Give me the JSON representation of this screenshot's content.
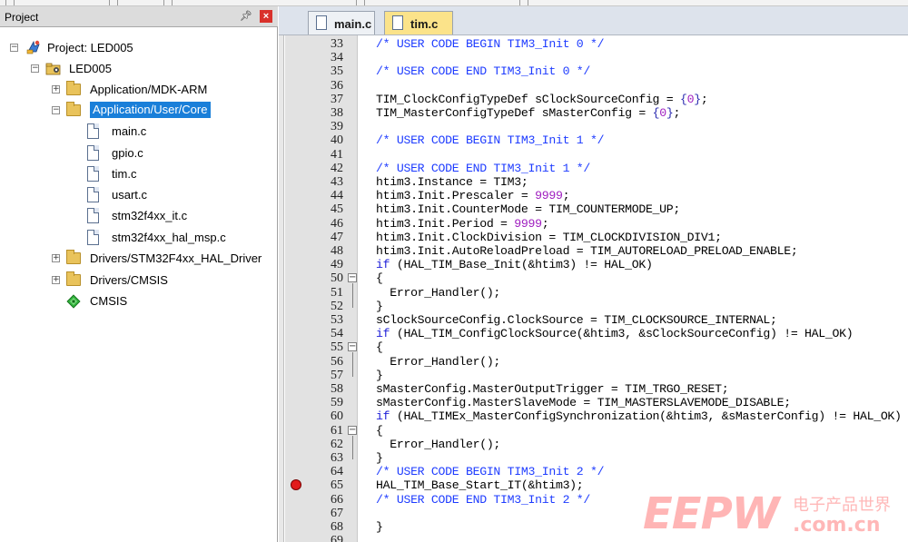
{
  "project_panel": {
    "title": "Project",
    "tree": [
      {
        "label": "Project: LED005",
        "icon": "project-icon",
        "expander": "minus"
      },
      {
        "label": "LED005",
        "icon": "target-group-icon",
        "expander": "minus"
      },
      {
        "label": "Application/MDK-ARM",
        "icon": "folder-icon",
        "expander": "plus"
      },
      {
        "label": "Application/User/Core",
        "icon": "folder-open-icon",
        "expander": "minus",
        "selected": true
      },
      {
        "label": "main.c",
        "icon": "c-file-icon"
      },
      {
        "label": "gpio.c",
        "icon": "c-file-icon"
      },
      {
        "label": "tim.c",
        "icon": "c-file-icon"
      },
      {
        "label": "usart.c",
        "icon": "c-file-icon"
      },
      {
        "label": "stm32f4xx_it.c",
        "icon": "c-file-icon"
      },
      {
        "label": "stm32f4xx_hal_msp.c",
        "icon": "c-file-icon"
      },
      {
        "label": "Drivers/STM32F4xx_HAL_Driver",
        "icon": "folder-icon",
        "expander": "plus"
      },
      {
        "label": "Drivers/CMSIS",
        "icon": "folder-icon",
        "expander": "plus"
      },
      {
        "label": "CMSIS",
        "icon": "cmsis-component-icon"
      }
    ]
  },
  "editor": {
    "tabs": [
      {
        "label": "main.c",
        "active": false
      },
      {
        "label": "tim.c",
        "active": true
      }
    ],
    "breakpoint_line": 65,
    "lines": [
      {
        "n": "33",
        "text": "/* USER CODE BEGIN TIM3_Init 0 */"
      },
      {
        "n": "34",
        "text": ""
      },
      {
        "n": "35",
        "text": "/* USER CODE END TIM3_Init 0 */"
      },
      {
        "n": "36",
        "text": ""
      },
      {
        "n": "37",
        "text": "TIM_ClockConfigTypeDef sClockSourceConfig = {0};"
      },
      {
        "n": "38",
        "text": "TIM_MasterConfigTypeDef sMasterConfig = {0};"
      },
      {
        "n": "39",
        "text": ""
      },
      {
        "n": "40",
        "text": "/* USER CODE BEGIN TIM3_Init 1 */"
      },
      {
        "n": "41",
        "text": ""
      },
      {
        "n": "42",
        "text": "/* USER CODE END TIM3_Init 1 */"
      },
      {
        "n": "43",
        "text": "htim3.Instance = TIM3;"
      },
      {
        "n": "44",
        "text": "htim3.Init.Prescaler = 9999;"
      },
      {
        "n": "45",
        "text": "htim3.Init.CounterMode = TIM_COUNTERMODE_UP;"
      },
      {
        "n": "46",
        "text": "htim3.Init.Period = 9999;"
      },
      {
        "n": "47",
        "text": "htim3.Init.ClockDivision = TIM_CLOCKDIVISION_DIV1;"
      },
      {
        "n": "48",
        "text": "htim3.Init.AutoReloadPreload = TIM_AUTORELOAD_PRELOAD_ENABLE;"
      },
      {
        "n": "49",
        "text": "if (HAL_TIM_Base_Init(&htim3) != HAL_OK)"
      },
      {
        "n": "50",
        "text": "{"
      },
      {
        "n": "51",
        "text": "  Error_Handler();"
      },
      {
        "n": "52",
        "text": "}"
      },
      {
        "n": "53",
        "text": "sClockSourceConfig.ClockSource = TIM_CLOCKSOURCE_INTERNAL;"
      },
      {
        "n": "54",
        "text": "if (HAL_TIM_ConfigClockSource(&htim3, &sClockSourceConfig) != HAL_OK)"
      },
      {
        "n": "55",
        "text": "{"
      },
      {
        "n": "56",
        "text": "  Error_Handler();"
      },
      {
        "n": "57",
        "text": "}"
      },
      {
        "n": "58",
        "text": "sMasterConfig.MasterOutputTrigger = TIM_TRGO_RESET;"
      },
      {
        "n": "59",
        "text": "sMasterConfig.MasterSlaveMode = TIM_MASTERSLAVEMODE_DISABLE;"
      },
      {
        "n": "60",
        "text": "if (HAL_TIMEx_MasterConfigSynchronization(&htim3, &sMasterConfig) != HAL_OK)"
      },
      {
        "n": "61",
        "text": "{"
      },
      {
        "n": "62",
        "text": "  Error_Handler();"
      },
      {
        "n": "63",
        "text": "}"
      },
      {
        "n": "64",
        "text": "/* USER CODE BEGIN TIM3_Init 2 */"
      },
      {
        "n": "65",
        "text": "HAL_TIM_Base_Start_IT(&htim3);"
      },
      {
        "n": "66",
        "text": "/* USER CODE END TIM3_Init 2 */"
      },
      {
        "n": "67",
        "text": ""
      },
      {
        "n": "68",
        "text": "}"
      },
      {
        "n": "69",
        "text": ""
      }
    ]
  },
  "watermark": {
    "brand": "EEPW",
    "tagline": "电子产品世界",
    "domain": ".com.cn"
  }
}
